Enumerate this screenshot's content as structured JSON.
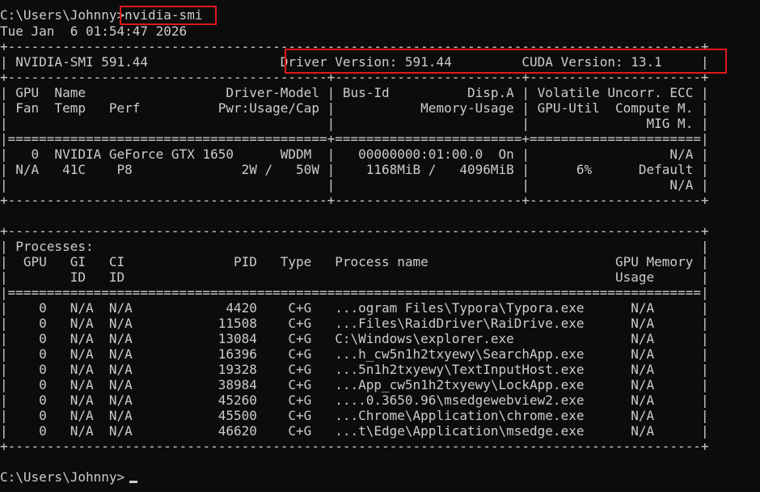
{
  "terminal": {
    "prompt_top": "C:\\Users\\Johnny>",
    "command": "nvidia-smi",
    "timestamp": "Tue Jan  6 01:54:47 2026",
    "prompt_bottom": "C:\\Users\\Johnny>",
    "accent_color": "#e0181c"
  },
  "gpu_table": {
    "border_top": "+-----------------------------------------------------------------------------------------+",
    "header_line": "| NVIDIA-SMI 591.44                 Driver Version: 591.44         CUDA Version: 13.1     |",
    "separator": "+-----------------------------------------+------------------------+----------------------+",
    "col_header_1": "| GPU  Name                  Driver-Model | Bus-Id          Disp.A | Volatile Uncorr. ECC |",
    "col_header_2": "| Fan  Temp   Perf          Pwr:Usage/Cap |           Memory-Usage | GPU-Util  Compute M. |",
    "col_header_3": "|                                         |                        |               MIG M. |",
    "double_separator": "|=========================================+========================+======================|",
    "row_1": "|   0  NVIDIA GeForce GTX 1650      WDDM  |   00000000:01:00.0  On |                  N/A |",
    "row_2": "| N/A   41C    P8              2W /   50W |    1168MiB /   4096MiB |      6%      Default |",
    "row_3": "|                                         |                        |                  N/A |",
    "bottom_border": "+-----------------------------------------+------------------------+----------------------+"
  },
  "process_table": {
    "border_top": "+-----------------------------------------------------------------------------------------+",
    "title_line": "| Processes:                                                                              |",
    "col_header_1": "|  GPU   GI   CI              PID   Type   Process name                        GPU Memory |",
    "col_header_2": "|        ID   ID                                                               Usage      |",
    "double_separator": "|=========================================================================================|",
    "rows": [
      "|    0   N/A  N/A            4420    C+G   ...ogram Files\\Typora\\Typora.exe      N/A      |",
      "|    0   N/A  N/A           11508    C+G   ...Files\\RaidDriver\\RaiDrive.exe      N/A      |",
      "|    0   N/A  N/A           13084    C+G   C:\\Windows\\explorer.exe               N/A      |",
      "|    0   N/A  N/A           16396    C+G   ...h_cw5n1h2txyewy\\SearchApp.exe      N/A      |",
      "|    0   N/A  N/A           19328    C+G   ...5n1h2txyewy\\TextInputHost.exe      N/A      |",
      "|    0   N/A  N/A           38984    C+G   ...App_cw5n1h2txyewy\\LockApp.exe      N/A      |",
      "|    0   N/A  N/A           45260    C+G   ....0.3650.96\\msedgewebview2.exe      N/A      |",
      "|    0   N/A  N/A           45500    C+G   ...Chrome\\Application\\chrome.exe      N/A      |",
      "|    0   N/A  N/A           46620    C+G   ...t\\Edge\\Application\\msedge.exe      N/A      |"
    ],
    "border_bottom": "+-----------------------------------------------------------------------------------------+"
  }
}
